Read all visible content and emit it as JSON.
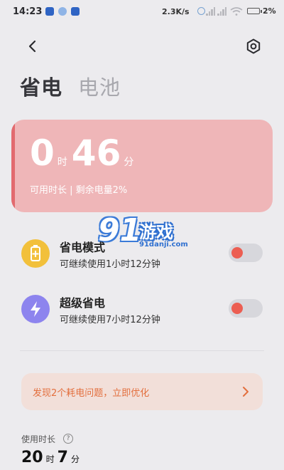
{
  "status_bar": {
    "time": "14:23",
    "network_speed": "2.3K/s",
    "battery_level": "2%",
    "icons": [
      "app-notification-icon",
      "app-notification-icon",
      "app-notification-icon",
      "alarm-icon",
      "signal-icon",
      "signal-icon",
      "wifi-icon",
      "battery-icon"
    ]
  },
  "header": {
    "back_icon": "chevron-left-icon",
    "settings_icon": "gear-icon"
  },
  "tabs": [
    {
      "label": "省电",
      "active": true
    },
    {
      "label": "电池",
      "active": false
    }
  ],
  "battery_card": {
    "hours": "0",
    "hours_unit": "时",
    "minutes": "46",
    "minutes_unit": "分",
    "subtitle": "可用时长 | 剩余电量2%",
    "color": "#efb6b8",
    "accent_color": "#e26a6f"
  },
  "watermark": {
    "logo_text": "91",
    "title": "游戏",
    "url": "91danji.com"
  },
  "modes": [
    {
      "title": "省电模式",
      "subtitle": "可继续使用1小时12分钟",
      "icon": "battery-plus-icon",
      "icon_color": "#f2c03b",
      "toggle_on": false
    },
    {
      "title": "超级省电",
      "subtitle": "可继续使用7小时12分钟",
      "icon": "lightning-icon",
      "icon_color": "#8d84ee",
      "toggle_on": false
    }
  ],
  "alert": {
    "text": "发现2个耗电问题，立即优化",
    "color": "#e36f3e"
  },
  "usage": {
    "label": "使用时长",
    "hours": "20",
    "hours_unit": "时",
    "minutes": "7",
    "minutes_unit": "分"
  }
}
